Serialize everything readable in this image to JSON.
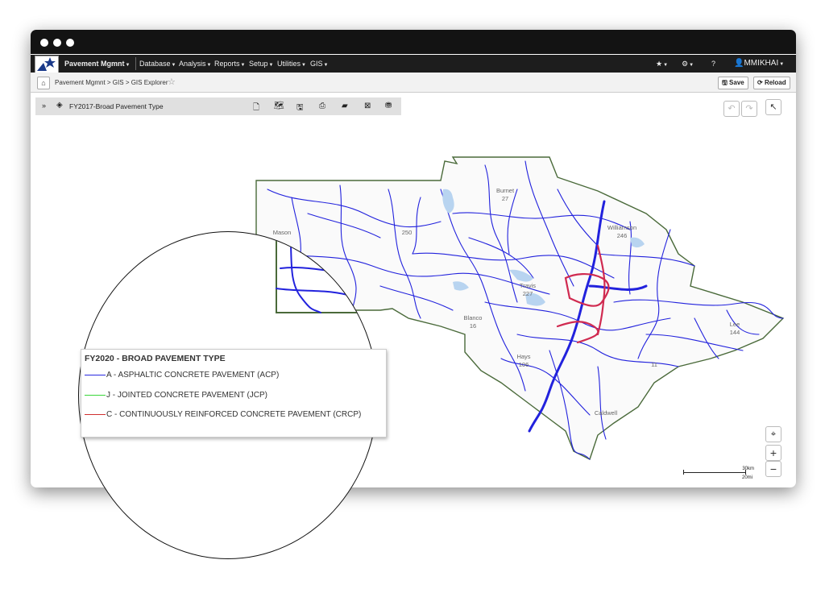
{
  "navbar": {
    "brand": "Pavement Mgmnt",
    "menus": [
      "Database",
      "Analysis",
      "Reports",
      "Setup",
      "Utilities",
      "GIS"
    ],
    "user": "MMIKHAI"
  },
  "breadcrumb": "Pavement Mgmnt > GIS > GIS Explorer",
  "toolbar": {
    "save_label": "Save",
    "reload_label": "Reload"
  },
  "layer": {
    "name": "FY2017-Broad Pavement Type"
  },
  "map_labels": [
    {
      "text": "Burnet"
    },
    {
      "text": "27"
    },
    {
      "text": "Williamson"
    },
    {
      "text": "246"
    },
    {
      "text": "Travis"
    },
    {
      "text": "227"
    },
    {
      "text": "Blanco"
    },
    {
      "text": "16"
    },
    {
      "text": "Lee"
    },
    {
      "text": "144"
    },
    {
      "text": "Hays"
    },
    {
      "text": "106"
    },
    {
      "text": "Caldwell"
    },
    {
      "text": "11"
    },
    {
      "text": "Mason"
    },
    {
      "text": "250"
    }
  ],
  "scale": {
    "km": "30km",
    "mi": "20mi"
  },
  "legend": {
    "title": "FY2020 - BROAD PAVEMENT TYPE",
    "items": [
      {
        "code": "A - ASPHALTIC CONCRETE PAVEMENT (ACP)",
        "color": "#2a2ae0"
      },
      {
        "code": "J - JOINTED CONCRETE PAVEMENT (JCP)",
        "color": "#3ad63a"
      },
      {
        "code": "C - CONTINUOUSLY REINFORCED CONCRETE PAVEMENT (CRCP)",
        "color": "#d03030"
      }
    ]
  },
  "colors": {
    "road": "#2222dd",
    "highway_red": "#d02a50",
    "boundary": "#4a6a3a"
  }
}
